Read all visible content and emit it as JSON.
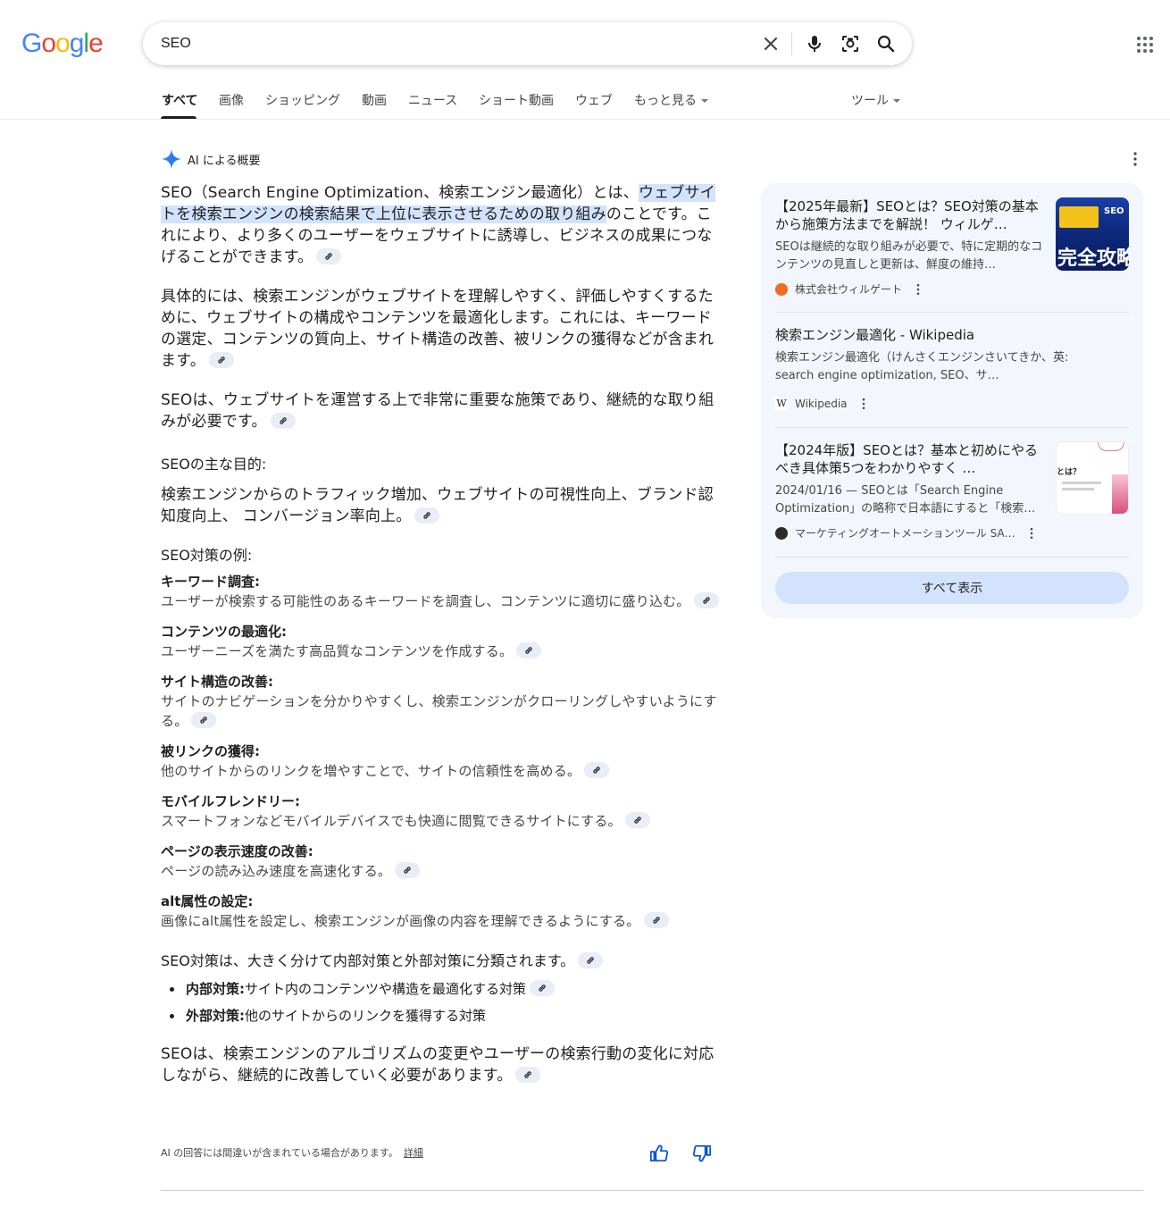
{
  "header": {
    "logo_letters": [
      "G",
      "o",
      "o",
      "g",
      "l",
      "e"
    ],
    "query": "SEO"
  },
  "colors": {
    "google_blue": "#4285F4",
    "google_red": "#EA4335",
    "google_yellow": "#FBBC05",
    "google_green": "#34A853",
    "highlight": "#d3e3fd",
    "panel_bg": "#f3f6fc"
  },
  "tabs": [
    "すべて",
    "画像",
    "ショッピング",
    "動画",
    "ニュース",
    "ショート動画",
    "ウェブ",
    "もっと見る",
    "ツール"
  ],
  "ai": {
    "label": "AI による概要",
    "p1_a": "SEO（Search Engine Optimization、検索エンジン最適化）とは、",
    "p1_hl": "ウェブサイトを検索エンジンの検索結果で上位に表示させるための取り組み",
    "p1_b": "のことです。これにより、より多くのユーザーをウェブサイトに誘導し、ビジネスの成果につなげることができます。",
    "p2": "具体的には、検索エンジンがウェブサイトを理解しやすく、評価しやすくするために、ウェブサイトの構成やコンテンツを最適化します。これには、キーワードの選定、コンテンツの質向上、サイト構造の改善、被リンクの獲得などが含まれます。",
    "p3": "SEOは、ウェブサイトを運営する上で非常に重要な施策であり、継続的な取り組みが必要です。",
    "goal_head": "SEOの主な目的:",
    "goal_text": "検索エンジンからのトラフィック増加、ウェブサイトの可視性向上、ブランド認知度向上、 コンバージョン率向上。",
    "examples_head": "SEO対策の例:",
    "examples": [
      {
        "title": "キーワード調査:",
        "desc": "ユーザーが検索する可能性のあるキーワードを調査し、コンテンツに適切に盛り込む。"
      },
      {
        "title": "コンテンツの最適化:",
        "desc": "ユーザーニーズを満たす高品質なコンテンツを作成する。"
      },
      {
        "title": "サイト構造の改善:",
        "desc": "サイトのナビゲーションを分かりやすくし、検索エンジンがクローリングしやすいようにする。"
      },
      {
        "title": "被リンクの獲得:",
        "desc": "他のサイトからのリンクを増やすことで、サイトの信頼性を高める。"
      },
      {
        "title": "モバイルフレンドリー:",
        "desc": "スマートフォンなどモバイルデバイスでも快適に閲覧できるサイトにする。"
      },
      {
        "title": "ページの表示速度の改善:",
        "desc": "ページの読み込み速度を高速化する。"
      },
      {
        "title": "alt属性の設定:",
        "desc": "画像にalt属性を設定し、検索エンジンが画像の内容を理解できるようにする。"
      }
    ],
    "split_text": "SEO対策は、大きく分けて内部対策と外部対策に分類されます。",
    "bullets": [
      {
        "b": "内部対策:",
        "t": "サイト内のコンテンツや構造を最適化する対策"
      },
      {
        "b": "外部対策:",
        "t": "他のサイトからのリンクを獲得する対策"
      }
    ],
    "final": "SEOは、検索エンジンのアルゴリズムの変更やユーザーの検索行動の変化に対応しながら、継続的に改善していく必要があります。",
    "disclaimer": "AI の回答には間違いが含まれている場合があります。",
    "details_link": "詳細"
  },
  "sources": [
    {
      "title": "【2025年最新】SEOとは？SEO対策の基本から施策方法までを解説！ ウィルゲ…",
      "snippet": "SEOは継続的な取り組みが必要で、特に定期的なコンテンツの見直しと更新は、鮮度の維持…",
      "site": "株式会社ウィルゲート"
    },
    {
      "title": "検索エンジン最適化 - Wikipedia",
      "snippet": "検索エンジン最適化（けんさくエンジンさいてきか、英: search engine optimization, SEO、サ…",
      "site": "Wikipedia"
    },
    {
      "title": "【2024年版】SEOとは？基本と初めにやるべき具体策5つをわかりやすく …",
      "snippet": "2024/01/16 — SEOとは「Search Engine Optimization」の略称で日本語にすると「検索…",
      "site": "マーケティングオートメーションツール SA…"
    }
  ],
  "thumb1_text": [
    "SEO",
    "完全攻略"
  ],
  "thumb3_text": "とは？",
  "show_all": "すべて表示"
}
